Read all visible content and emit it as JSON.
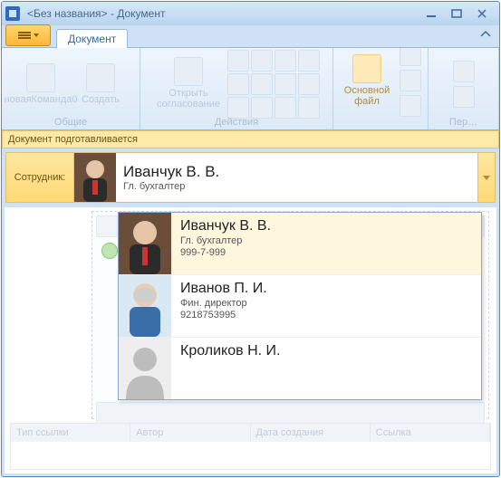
{
  "window": {
    "title": "<Без названия> - Документ"
  },
  "tabs": {
    "document": "Документ"
  },
  "ribbon": {
    "group_general": "Общие",
    "group_actions": "Действия",
    "group_mainfile": "Основной файл",
    "group_rel": "Пер…",
    "btn_new_cmd": "новаяКоманда0",
    "btn_create": "Создать",
    "btn_open_approval": "Открыть согласование"
  },
  "status": {
    "text": "Документ подготавливается"
  },
  "selector": {
    "label": "Сотрудник:",
    "name": "Иванчук В. В.",
    "role": "Гл. бухгалтер"
  },
  "dropdown": {
    "items": [
      {
        "name": "Иванчук В. В.",
        "role": "Гл. бухгалтер",
        "phone": "999-7-999"
      },
      {
        "name": "Иванов П. И.",
        "role": "Фин. директор",
        "phone": "9218753995"
      },
      {
        "name": "Кроликов Н. И.",
        "role": "",
        "phone": ""
      }
    ]
  },
  "table": {
    "cols": [
      "Тип ссылки",
      "Автор",
      "Дата создания",
      "Ссылка"
    ]
  }
}
